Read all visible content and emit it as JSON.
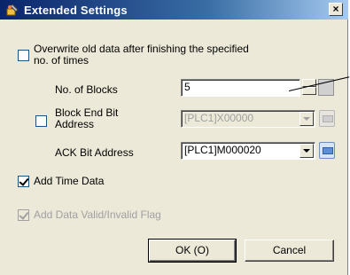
{
  "window": {
    "title": "Extended Settings",
    "close_glyph": "×"
  },
  "overwrite": {
    "label_line1": "Overwrite old data after finishing the specified",
    "label_line2": "no. of times",
    "checked": false
  },
  "blocks": {
    "label": "No. of Blocks",
    "value": "5"
  },
  "block_end": {
    "label_line1": "Block End Bit",
    "label_line2": "Address",
    "value": "[PLC1]X00000",
    "checked": false,
    "enabled": false
  },
  "ack": {
    "label": "ACK Bit Address",
    "value": "[PLC1]M000020"
  },
  "time_data": {
    "label": "Add Time Data",
    "checked": true
  },
  "valid_flag": {
    "label": "Add Data Valid/Invalid Flag",
    "checked": true,
    "enabled": false
  },
  "buttons": {
    "ok": "OK (O)",
    "cancel": "Cancel"
  },
  "icons": {
    "title": "settings-wrench-icon",
    "spin_up": "arrow-up-icon",
    "spin_down": "arrow-down-icon",
    "combo": "chevron-down-icon",
    "picker": "address-picker-icon"
  },
  "colors": {
    "title_start": "#0a246a",
    "title_end": "#a6caf0",
    "dialog_bg": "#ece9d8",
    "disabled_text": "#a0a0a0"
  }
}
